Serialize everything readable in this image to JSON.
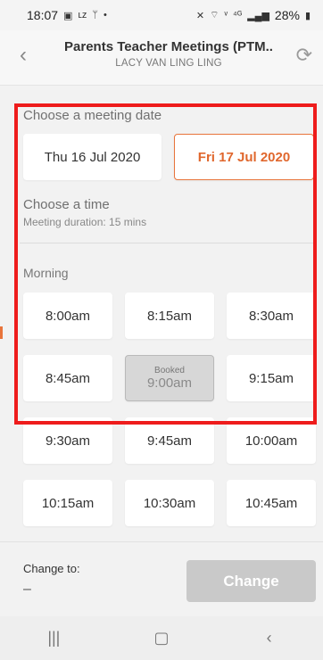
{
  "status_bar": {
    "time": "18:07",
    "battery": "28%",
    "left_icons": [
      "image-icon",
      "lz-icon",
      "usb-icon",
      "dot-icon"
    ],
    "right_icons": [
      "mute-icon",
      "wifi-icon",
      "volte-icon",
      "4g-icon",
      "signal-icon",
      "battery-icon"
    ]
  },
  "header": {
    "title": "Parents Teacher Meetings (PTM..",
    "subtitle": "LACY VAN LING LING"
  },
  "meeting_date": {
    "label": "Choose a meeting date",
    "dates": [
      {
        "label": "Thu 16 Jul 2020",
        "selected": false
      },
      {
        "label": "Fri 17 Jul 2020",
        "selected": true
      }
    ]
  },
  "time": {
    "label": "Choose a time",
    "duration": "Meeting duration: 15 mins",
    "period": "Morning",
    "slots": [
      {
        "time": "8:00am"
      },
      {
        "time": "8:15am"
      },
      {
        "time": "8:30am"
      },
      {
        "time": "8:45am"
      },
      {
        "time": "9:00am",
        "booked": true,
        "booked_label": "Booked"
      },
      {
        "time": "9:15am"
      },
      {
        "time": "9:30am"
      },
      {
        "time": "9:45am"
      },
      {
        "time": "10:00am"
      },
      {
        "time": "10:15am"
      },
      {
        "time": "10:30am"
      },
      {
        "time": "10:45am"
      }
    ]
  },
  "footer": {
    "change_to_label": "Change to:",
    "change_to_value": "–",
    "change_button": "Change"
  },
  "colors": {
    "accent": "#e8743b",
    "highlight": "#ee1c1c",
    "disabled": "#c9c9c9"
  }
}
